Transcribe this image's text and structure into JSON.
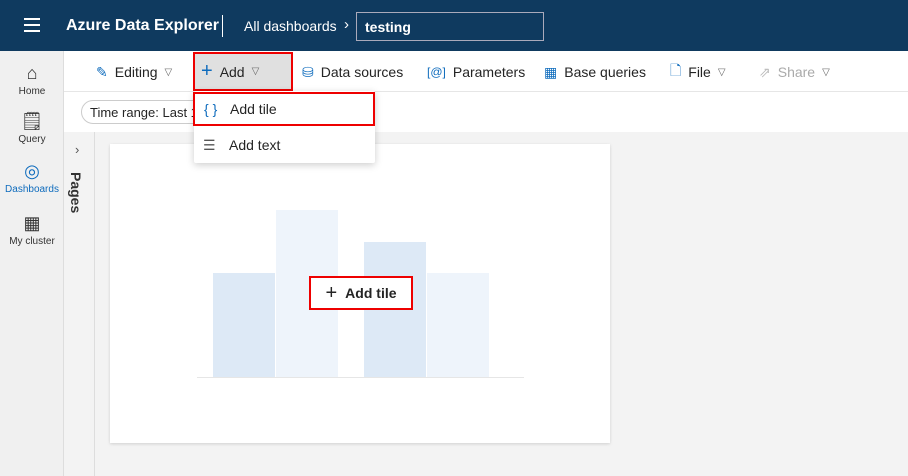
{
  "header": {
    "menu_icon": "hamburger-icon",
    "app_title": "Azure Data Explorer",
    "breadcrumb": "All dashboards",
    "dashboard_name": "testing"
  },
  "rail": [
    {
      "label": "Home",
      "icon": "home-icon"
    },
    {
      "label": "Query",
      "icon": "query-icon"
    },
    {
      "label": "Dashboards",
      "icon": "dashboard-icon"
    },
    {
      "label": "My cluster",
      "icon": "cluster-icon"
    }
  ],
  "toolbar": {
    "editing": "Editing",
    "add": "Add",
    "data_sources": "Data sources",
    "parameters": "Parameters",
    "base_queries": "Base queries",
    "file": "File",
    "share": "Share"
  },
  "filter": {
    "time_range": "Time range: Last 1"
  },
  "pages": {
    "label": "Pages"
  },
  "add_menu": {
    "add_tile": "Add tile",
    "add_text": "Add text"
  },
  "canvas": {
    "add_tile": "Add tile"
  },
  "colors": {
    "header": "#0f3a5f",
    "accent": "#0f6cbd",
    "highlight": "#e00000"
  }
}
